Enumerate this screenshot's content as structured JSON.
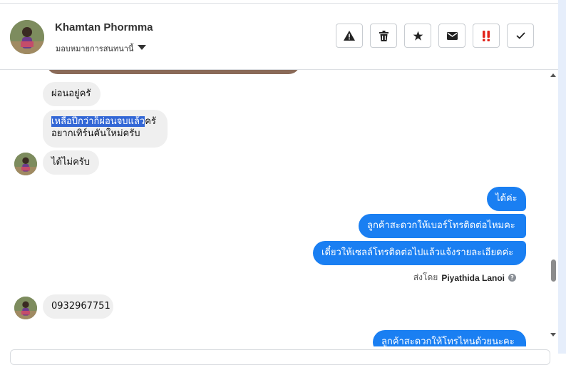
{
  "header": {
    "name": "Khamtan Phormma",
    "assign_label": "มอบหมายการสนทนานี้",
    "tools": [
      "warning-icon",
      "trash-icon",
      "star-icon",
      "envelope-icon",
      "double-exclamation-icon",
      "check-icon"
    ]
  },
  "messages": {
    "m1": "ผ่อนอยู่ครั",
    "m2_selected": "เหลือปีกว่าก็ผ่อนจบแล้ว",
    "m2_rest": "ครั",
    "m2_line2": "อยากเทิร์นคันใหม่ครับ",
    "m3": "ได้ไม่ครับ",
    "o1": "ได้ค่ะ",
    "o2": "ลูกค้าสะดวกให้เบอร์โทรติดต่อไหมคะ",
    "o3": "เดี๋ยวให้เซลล์โทรติดต่อไปแล้วแจ้งรายละเอียดค่ะ",
    "sent_by_prefix": "ส่งโดย",
    "sent_by_name": "Piyathida Lanoi",
    "m4": "0932967751",
    "o4": "ลูกค้าสะดวกให้โทรไหนด้วยนะคะ"
  },
  "colors": {
    "outgoing": "#1a7ff2",
    "incoming": "#efefef",
    "selection": "#3367d6"
  }
}
